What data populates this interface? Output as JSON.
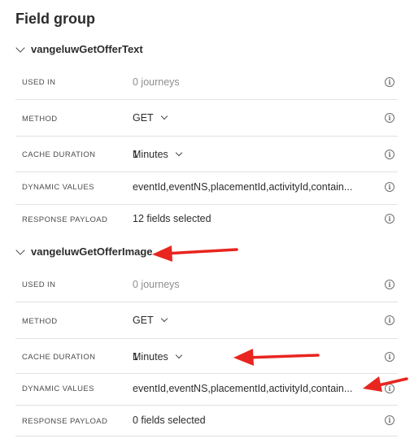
{
  "title": "Field group",
  "groups": [
    {
      "name": "vangeluwGetOfferText",
      "used_in": {
        "label": "USED IN",
        "value": "0 journeys"
      },
      "method": {
        "label": "METHOD",
        "value": "GET"
      },
      "cache_duration": {
        "label": "CACHE DURATION",
        "value": "1",
        "unit": "Minutes"
      },
      "dynamic_values": {
        "label": "DYNAMIC VALUES",
        "value": "eventId,eventNS,placementId,activityId,contain..."
      },
      "response_payload": {
        "label": "RESPONSE PAYLOAD",
        "value": "12 fields selected"
      }
    },
    {
      "name": "vangeluwGetOfferImage",
      "used_in": {
        "label": "USED IN",
        "value": "0 journeys"
      },
      "method": {
        "label": "METHOD",
        "value": "GET"
      },
      "cache_duration": {
        "label": "CACHE DURATION",
        "value": "1",
        "unit": "Minutes"
      },
      "dynamic_values": {
        "label": "DYNAMIC VALUES",
        "value": "eventId,eventNS,placementId,activityId,contain..."
      },
      "response_payload": {
        "label": "RESPONSE PAYLOAD",
        "value": "0 fields selected"
      }
    }
  ],
  "icons": {
    "chevron": "chevron-down-icon",
    "info": "info-icon",
    "annotation": "red-arrow"
  },
  "colors": {
    "annotation_arrow": "#e8251f",
    "divider": "#e1e1e1",
    "muted_text": "#8e8e8e"
  }
}
